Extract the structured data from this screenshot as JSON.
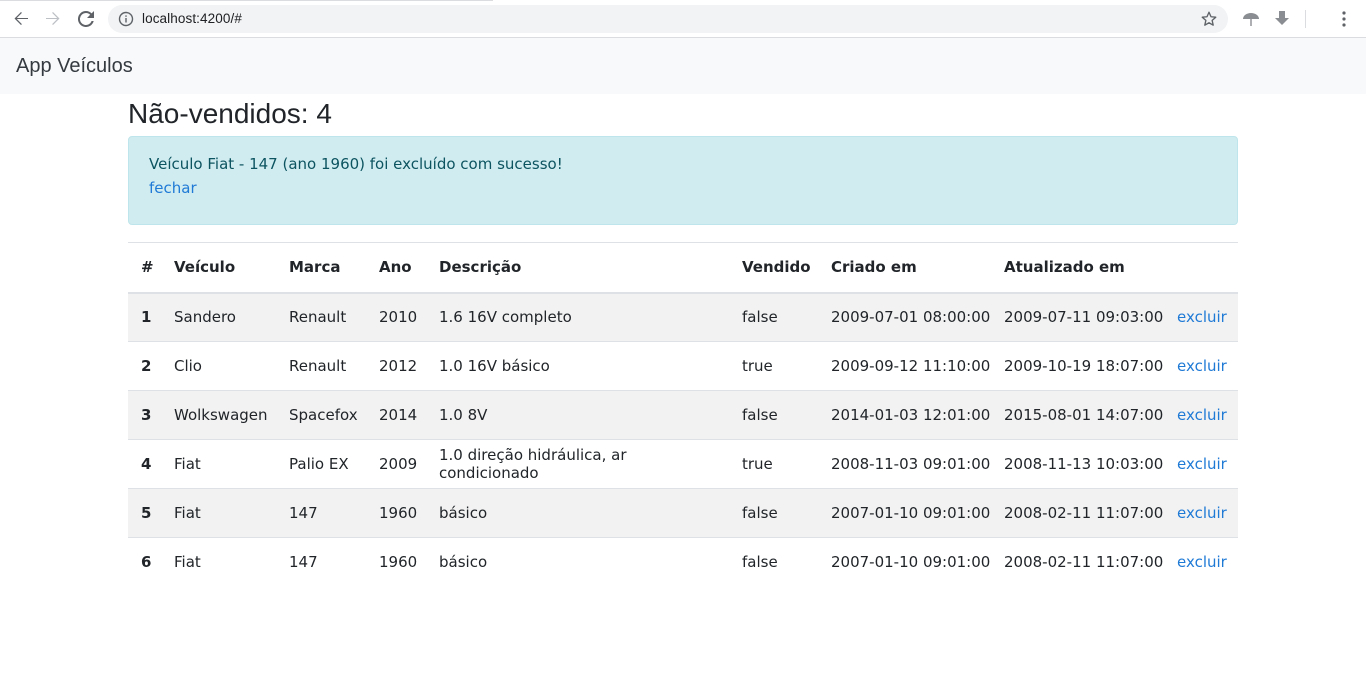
{
  "browser": {
    "url": "localhost:4200/#"
  },
  "navbar": {
    "brand": "App Veículos"
  },
  "main": {
    "title": "Não-vendidos: 4",
    "alert": {
      "message": "Veículo Fiat - 147 (ano 1960) foi excluído com sucesso!",
      "close_link": "fechar"
    },
    "table": {
      "headers": [
        "#",
        "Veículo",
        "Marca",
        "Ano",
        "Descrição",
        "Vendido",
        "Criado em",
        "Atualizado em",
        ""
      ],
      "rows": [
        [
          "1",
          "Sandero",
          "Renault",
          "2010",
          "1.6 16V completo",
          "false",
          "2009-07-01 08:00:00",
          "2009-07-11 09:03:00",
          "excluir"
        ],
        [
          "2",
          "Clio",
          "Renault",
          "2012",
          "1.0 16V básico",
          "true",
          "2009-09-12 11:10:00",
          "2009-10-19 18:07:00",
          "excluir"
        ],
        [
          "3",
          "Wolkswagen",
          "Spacefox",
          "2014",
          "1.0 8V",
          "false",
          "2014-01-03 12:01:00",
          "2015-08-01 14:07:00",
          "excluir"
        ],
        [
          "4",
          "Fiat",
          "Palio EX",
          "2009",
          "1.0 direção hidráulica, ar condicionado",
          "true",
          "2008-11-03 09:01:00",
          "2008-11-13 10:03:00",
          "excluir"
        ],
        [
          "5",
          "Fiat",
          "147",
          "1960",
          "básico",
          "false",
          "2007-01-10 09:01:00",
          "2008-02-11 11:07:00",
          "excluir"
        ],
        [
          "6",
          "Fiat",
          "147",
          "1960",
          "básico",
          "false",
          "2007-01-10 09:01:00",
          "2008-02-11 11:07:00",
          "excluir"
        ]
      ]
    }
  }
}
